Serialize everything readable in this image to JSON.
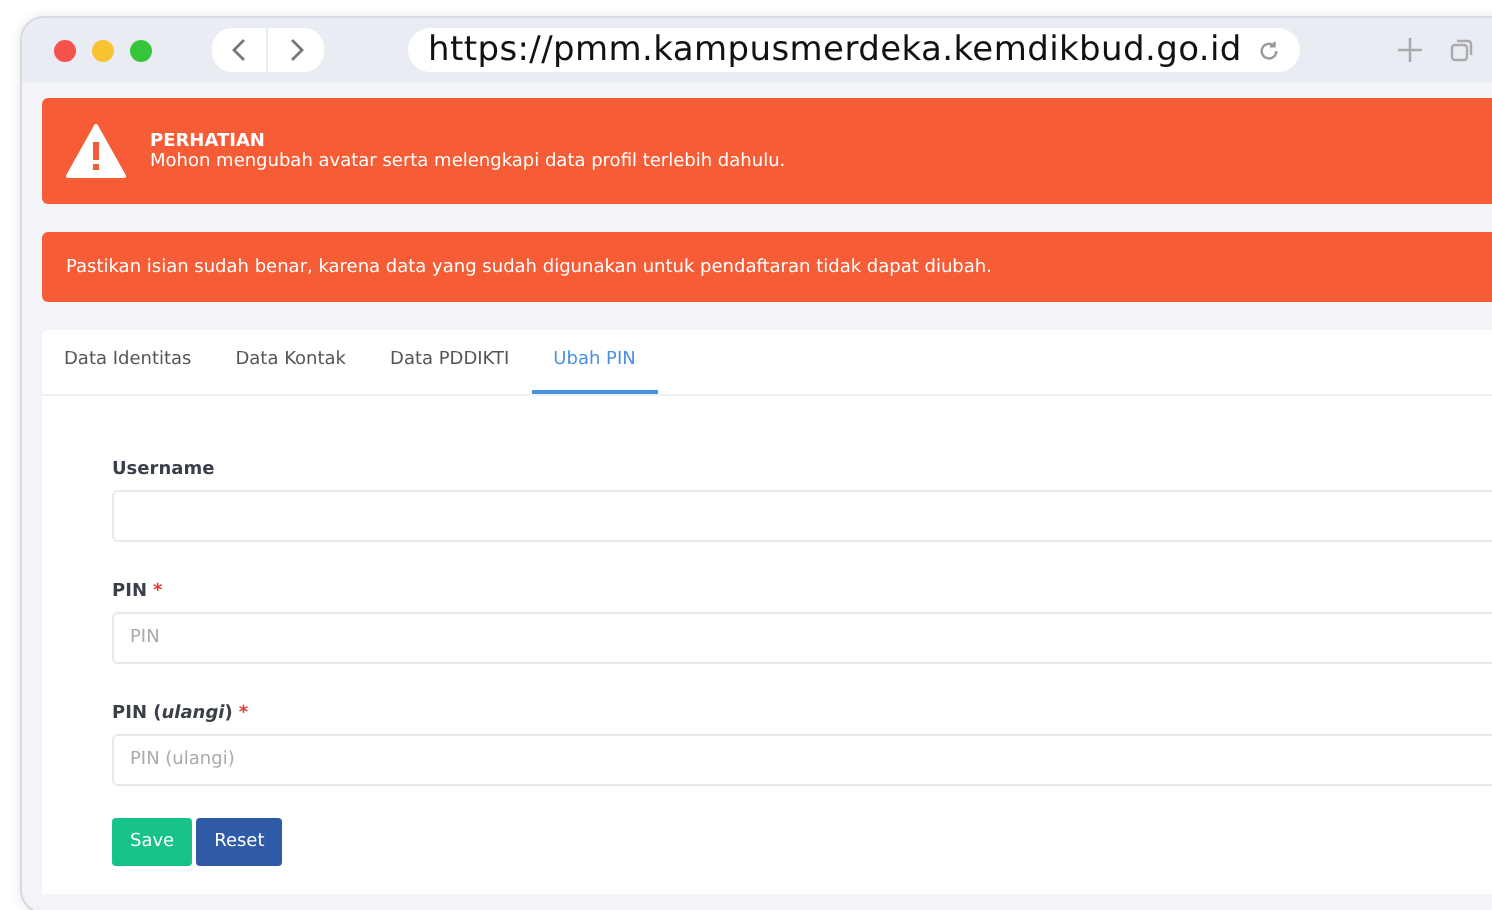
{
  "browser": {
    "url": "https://pmm.kampusmerdeka.kemdikbud.go.id"
  },
  "alerts": [
    {
      "kind": "icon",
      "title": "PERHATIAN",
      "message": "Mohon mengubah avatar serta melengkapi data profil terlebih dahulu."
    },
    {
      "kind": "plain",
      "message": "Pastikan isian sudah benar, karena data yang sudah digunakan untuk pendaftaran tidak dapat diubah."
    }
  ],
  "tabs": [
    {
      "label": "Data Identitas",
      "selected": false
    },
    {
      "label": "Data Kontak",
      "selected": false
    },
    {
      "label": "Data PDDIKTI",
      "selected": false
    },
    {
      "label": "Ubah PIN",
      "selected": true
    }
  ],
  "fields": [
    {
      "label": "Username"
    },
    {
      "label": "PIN",
      "required_mark": "*",
      "placeholder": "PIN"
    },
    {
      "label": "PIN (*ulangi*)",
      "required_mark": "*",
      "placeholder": "PIN (ulangi)"
    }
  ],
  "buttons": [
    {
      "kind": "save",
      "label": "Save"
    },
    {
      "kind": "reset",
      "label": "Reset"
    }
  ]
}
